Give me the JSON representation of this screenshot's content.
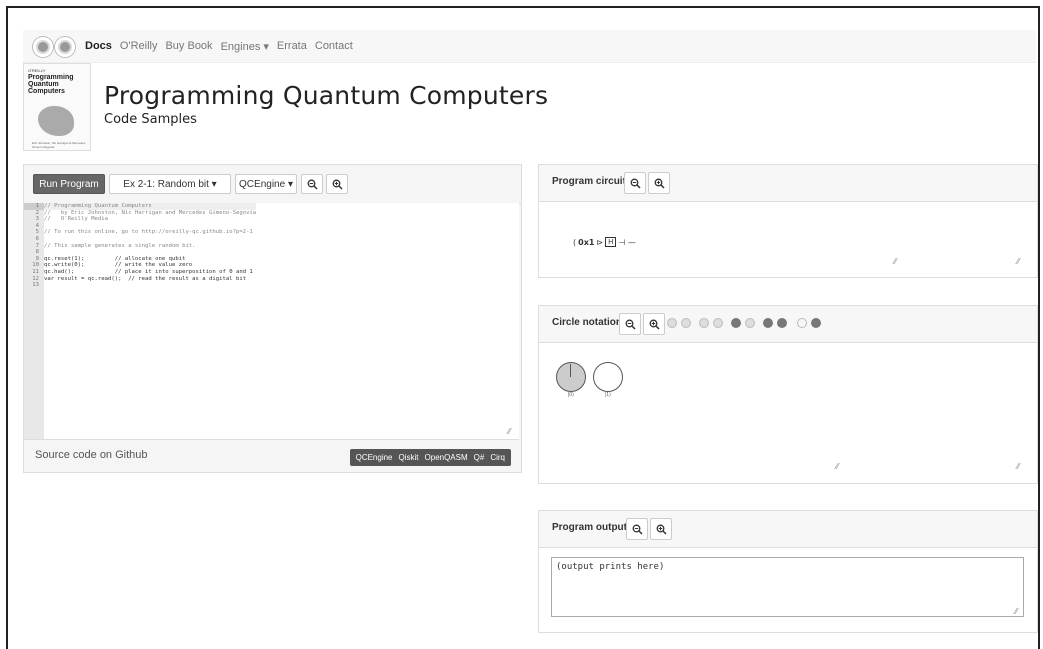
{
  "nav": {
    "links": [
      "Docs",
      "O'Reilly",
      "Buy Book",
      "Engines ▾",
      "Errata",
      "Contact"
    ]
  },
  "book": {
    "small": "O'REILLY",
    "title_lines": [
      "Programming",
      "Quantum",
      "Computers"
    ],
    "footer": "Eric Johnston, Nic Harrigan & Mercedes Gimeno-Segovia"
  },
  "page": {
    "title": "Programming Quantum Computers",
    "subtitle": "Code Samples"
  },
  "code_panel": {
    "run_button": "Run Program",
    "example_select": "Ex 2-1: Random bit ▾",
    "engine_select": "QCEngine ▾",
    "lines": [
      {
        "n": "1",
        "t": "// Programming Quantum Computers",
        "c": true
      },
      {
        "n": "2",
        "t": "//   by Eric Johnston, Nic Harrigan and Mercedes Gimeno-Segovia",
        "c": true
      },
      {
        "n": "3",
        "t": "//   O'Reilly Media",
        "c": true
      },
      {
        "n": "4",
        "t": "",
        "c": false
      },
      {
        "n": "5",
        "t": "// To run this online, go to http://oreilly-qc.github.io?p=2-1",
        "c": true
      },
      {
        "n": "6",
        "t": "",
        "c": false
      },
      {
        "n": "7",
        "t": "// This sample generates a single random bit.",
        "c": true
      },
      {
        "n": "8",
        "t": "",
        "c": false
      },
      {
        "n": "9",
        "t": "qc.reset(1);         // allocate one qubit",
        "c": false
      },
      {
        "n": "10",
        "t": "qc.write(0);         // write the value zero",
        "c": false
      },
      {
        "n": "11",
        "t": "qc.had();            // place it into superposition of 0 and 1",
        "c": false
      },
      {
        "n": "12",
        "t": "var result = qc.read();  // read the result as a digital bit",
        "c": false
      },
      {
        "n": "13",
        "t": "",
        "c": false
      }
    ],
    "source_link": "Source code on Github",
    "languages": [
      "QCEngine",
      "Qiskit",
      "OpenQASM",
      "Q#",
      "Cirq"
    ]
  },
  "circuit_panel": {
    "label": "Program circuit",
    "init": "0x1",
    "gate": "H"
  },
  "circle_panel": {
    "label": "Circle notation",
    "state_labels": [
      "|0⟩",
      "|1⟩"
    ]
  },
  "output_panel": {
    "label": "Program output",
    "text": "(output prints here)"
  },
  "icons": {
    "zoom_out": "zoom-out-icon",
    "zoom_in": "zoom-in-icon"
  }
}
